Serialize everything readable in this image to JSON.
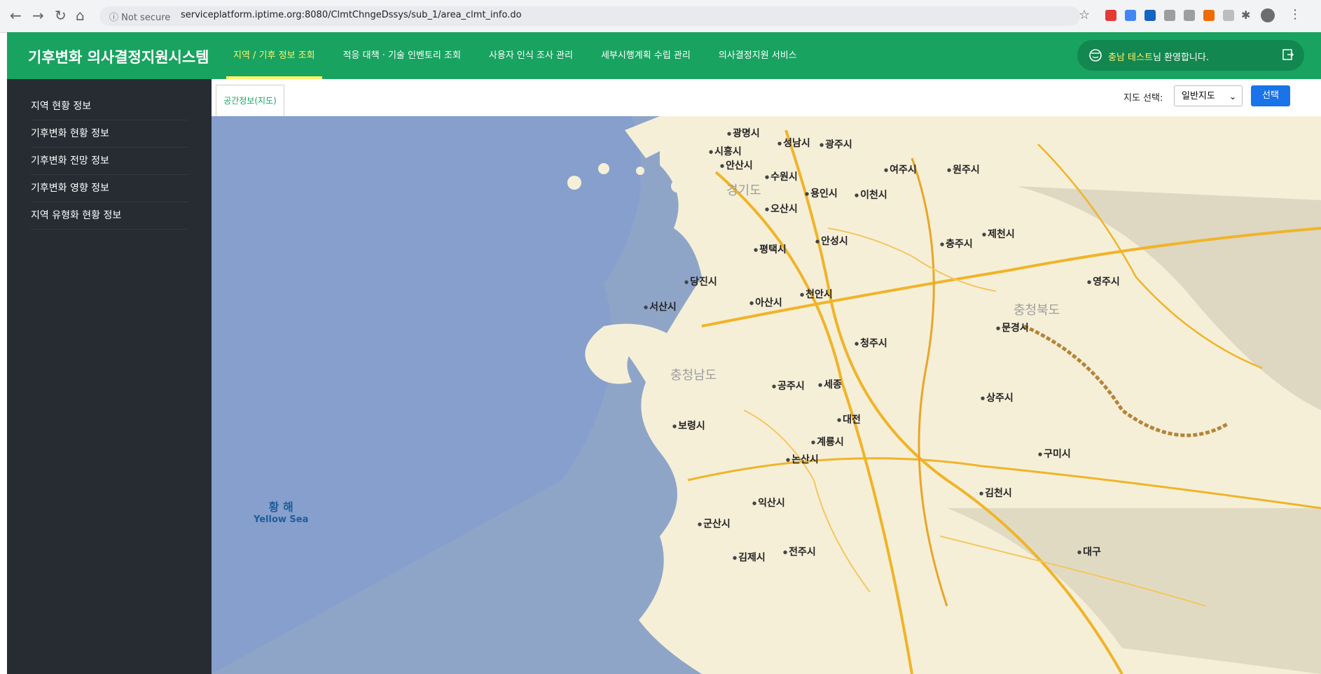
{
  "browser": {
    "security": "Not secure",
    "url": "serviceplatform.iptime.org:8080/ClmtChngeDssys/sub_1/area_clmt_info.do"
  },
  "app": {
    "title": "기후변화 의사결정지원시스템",
    "menu": [
      "지역 / 기후 정보 조회",
      "적응 대책 · 기술 인벤토리 조회",
      "사용자 인식 조사 관리",
      "세부시행계획 수립 관리",
      "의사결정지원 서비스"
    ],
    "welcome_name": "충남 테스트",
    "welcome_suffix": "님 환영합니다."
  },
  "sidebar": {
    "items": [
      "지역 현황 정보",
      "기후변화 현황 정보",
      "기후변화 전망 정보",
      "기후변화 영향 정보",
      "지역 유형화 현황 정보"
    ]
  },
  "content": {
    "tab": "공간정보(지도)",
    "map_select_label": "지도 선택:",
    "map_select_value": "일반지도",
    "select_button": "선택"
  },
  "map": {
    "sea_ko": "황 해",
    "sea_en": "Yellow Sea",
    "provinces": [
      "경기도",
      "충청북도",
      "충청남도"
    ],
    "cities": [
      "광명시",
      "시흥시",
      "안산시",
      "수원시",
      "성남시",
      "광주시",
      "여주시",
      "원주시",
      "용인시",
      "이천시",
      "오산시",
      "평택시",
      "안성시",
      "충주시",
      "제천시",
      "당진시",
      "아산시",
      "천안시",
      "서산시",
      "청주시",
      "문경시",
      "영주시",
      "공주시",
      "세종",
      "상주시",
      "보령시",
      "대전",
      "계룡시",
      "논산시",
      "구미시",
      "김천시",
      "익산시",
      "군산시",
      "전주시",
      "김제시",
      "대구"
    ]
  }
}
